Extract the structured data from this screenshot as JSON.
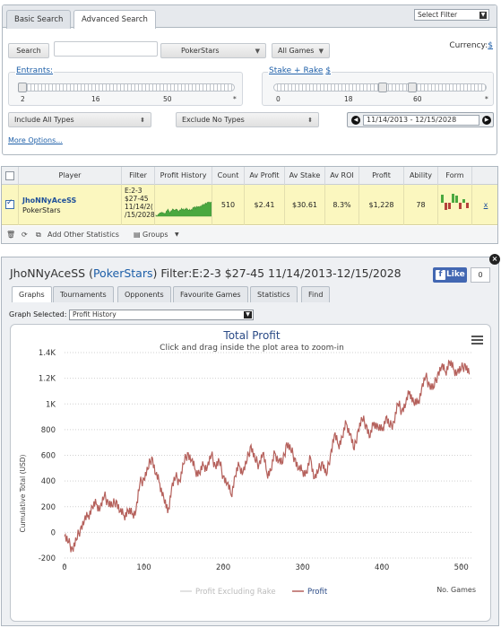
{
  "search": {
    "tabs": [
      {
        "label": "Basic Search"
      },
      {
        "label": "Advanced Search"
      }
    ],
    "select_filter": "Select Filter",
    "search_button": "Search",
    "search_input_value": "",
    "network": "PokerStars",
    "games": "All Games",
    "currency_label": "Currency:",
    "currency_value": "$",
    "entrants": {
      "label": "Entrants:",
      "ticks": [
        "2",
        "16",
        "50",
        "*"
      ]
    },
    "stake": {
      "label": "Stake + Rake",
      "unit": "$",
      "ticks": [
        "0",
        "18",
        "60",
        "*"
      ]
    },
    "include_types": "Include All Types",
    "exclude_types": "Exclude No Types",
    "date_range": "11/14/2013 - 12/15/2028",
    "more_options": "More Options..."
  },
  "results": {
    "headers": [
      "Player",
      "Filter",
      "Profit History",
      "Count",
      "Av Profit",
      "Av Stake",
      "Av ROI",
      "Profit",
      "Ability",
      "Form"
    ],
    "row": {
      "player_name": "JhoNNyAceSS",
      "player_network": "PokerStars",
      "filter_lines": [
        "E:2-3",
        "$27-45",
        "11/14/2(",
        "/15/2028"
      ],
      "count": "510",
      "av_profit": "$2.41",
      "av_stake": "$30.61",
      "av_roi": "8.3%",
      "profit": "$1,228",
      "ability": "78",
      "extra": "x"
    },
    "footer": {
      "add_stats": "Add Other Statistics",
      "groups": "Groups"
    }
  },
  "player_panel": {
    "title_prefix": "JhoNNyAceSS (",
    "title_network": "PokerStars",
    "title_suffix": ") Filter:E:2-3 $27-45 11/14/2013-12/15/2028",
    "like_label": "Like",
    "like_count": "0",
    "close": "×",
    "tabs": [
      {
        "label": "Graphs"
      },
      {
        "label": "Tournaments"
      },
      {
        "label": "Opponents"
      },
      {
        "label": "Favourite Games"
      },
      {
        "label": "Statistics"
      },
      {
        "label": "Find"
      }
    ],
    "graph_selected_label": "Graph Selected:",
    "graph_selected_value": "Profit History"
  },
  "colors": {
    "profit_line": "#b5615c",
    "profit_ex_rake": "#d9d9d9",
    "title": "#2a4a86",
    "sparkline": "#4aa83f"
  },
  "chart_data": {
    "type": "line",
    "title": "Total Profit",
    "subtitle": "Click and drag inside the plot area to zoom-in",
    "xlabel": "No. Games",
    "ylabel": "Cumulative Total (USD)",
    "xlim": [
      0,
      515
    ],
    "ylim": [
      -200,
      1400
    ],
    "xticks": [
      0,
      100,
      200,
      300,
      400,
      500
    ],
    "yticks": [
      -200,
      0,
      200,
      400,
      600,
      800,
      1000,
      1200,
      1400
    ],
    "ytick_labels": [
      "-200",
      "0",
      "200",
      "400",
      "600",
      "800",
      "1K",
      "1.2K",
      "1.4K"
    ],
    "legend": [
      "Profit Excluding Rake",
      "Profit"
    ],
    "series": [
      {
        "name": "Profit",
        "x": [
          0,
          5,
          10,
          15,
          20,
          25,
          30,
          35,
          40,
          45,
          50,
          55,
          60,
          65,
          70,
          75,
          80,
          85,
          90,
          95,
          100,
          105,
          110,
          115,
          120,
          125,
          130,
          135,
          140,
          145,
          150,
          155,
          160,
          165,
          170,
          175,
          180,
          185,
          190,
          195,
          200,
          205,
          210,
          215,
          220,
          225,
          230,
          235,
          240,
          245,
          250,
          255,
          260,
          265,
          270,
          275,
          280,
          285,
          290,
          295,
          300,
          305,
          310,
          315,
          320,
          325,
          330,
          335,
          340,
          345,
          350,
          355,
          360,
          365,
          370,
          375,
          380,
          385,
          390,
          395,
          400,
          405,
          410,
          415,
          420,
          425,
          430,
          435,
          440,
          445,
          450,
          455,
          460,
          465,
          470,
          475,
          480,
          485,
          490,
          495,
          500,
          505,
          510
        ],
        "values": [
          -30,
          -80,
          -130,
          -60,
          30,
          90,
          130,
          200,
          220,
          190,
          280,
          240,
          200,
          250,
          160,
          130,
          170,
          140,
          170,
          380,
          420,
          490,
          590,
          450,
          380,
          270,
          150,
          350,
          430,
          400,
          530,
          620,
          560,
          480,
          460,
          520,
          510,
          600,
          520,
          550,
          440,
          380,
          290,
          440,
          520,
          470,
          560,
          680,
          560,
          530,
          620,
          460,
          480,
          620,
          560,
          540,
          700,
          640,
          580,
          490,
          480,
          460,
          580,
          420,
          480,
          550,
          440,
          600,
          760,
          680,
          740,
          850,
          770,
          640,
          800,
          880,
          840,
          740,
          860,
          820,
          790,
          900,
          820,
          860,
          1000,
          950,
          1000,
          1100,
          1010,
          1000,
          1120,
          1210,
          1150,
          1120,
          1230,
          1290,
          1250,
          1330,
          1270,
          1250,
          1270,
          1310,
          1230
        ]
      }
    ]
  }
}
